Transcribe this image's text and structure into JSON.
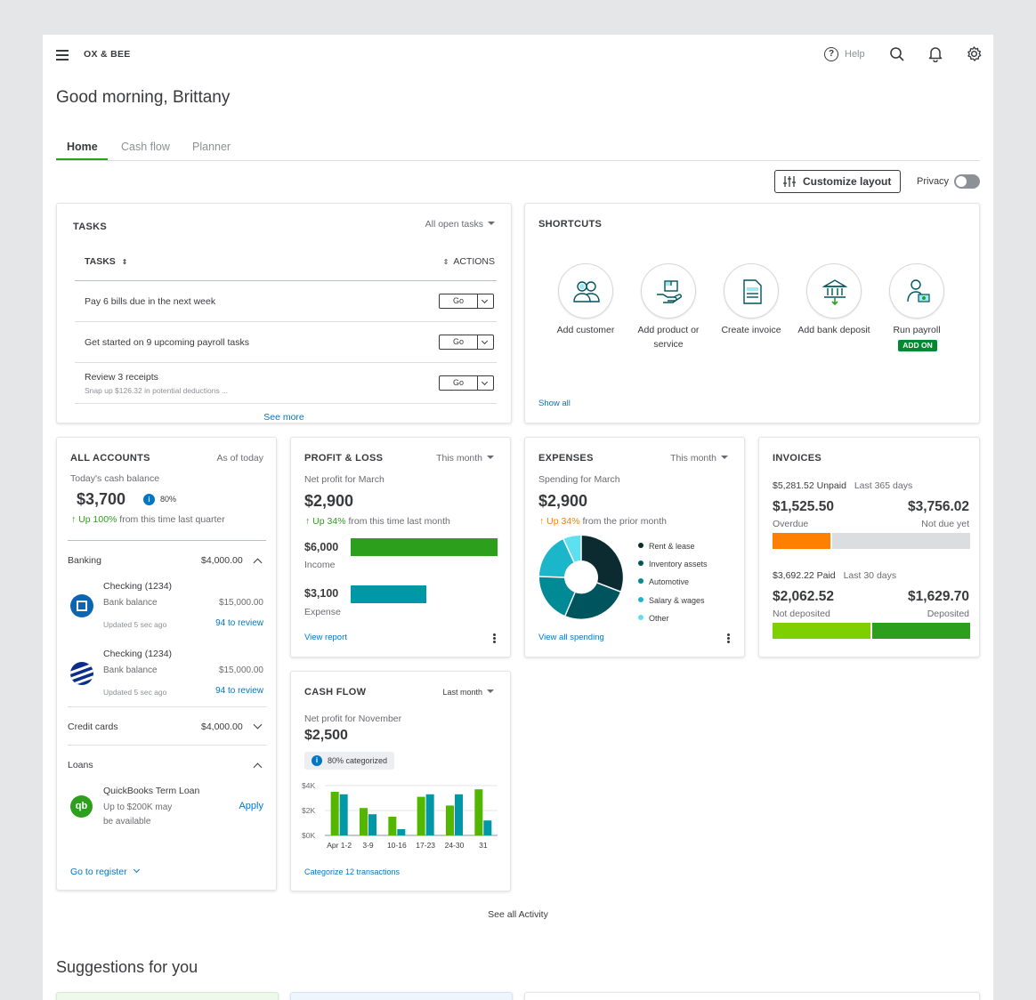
{
  "header": {
    "company": "OX & BEE",
    "help": "Help"
  },
  "greeting": "Good morning, Brittany",
  "tabs": [
    "Home",
    "Cash flow",
    "Planner"
  ],
  "customize": "Customize layout",
  "privacy": "Privacy",
  "tasks": {
    "title": "TASKS",
    "filter": "All open tasks",
    "col_tasks": "TASKS",
    "col_actions": "ACTIONS",
    "items": [
      {
        "label": "Pay 6 bills due in the next week",
        "sub": "",
        "btn": "Go"
      },
      {
        "label": "Get started on 9 upcoming payroll tasks",
        "sub": "",
        "btn": "Go"
      },
      {
        "label": "Review 3 receipts",
        "sub": "Snap up $126.32 in potential deductions ...",
        "btn": "Go"
      }
    ],
    "see_more": "See more"
  },
  "shortcuts": {
    "title": "SHORTCUTS",
    "items": [
      {
        "label": "Add customer",
        "icon": "customers-icon"
      },
      {
        "label": "Add product or service",
        "icon": "product-icon"
      },
      {
        "label": "Create invoice",
        "icon": "invoice-icon"
      },
      {
        "label": "Add bank deposit",
        "icon": "bank-deposit-icon"
      },
      {
        "label": "Run payroll",
        "icon": "payroll-icon"
      }
    ],
    "add_on": "ADD ON",
    "show_all": "Show all"
  },
  "accounts": {
    "title": "ALL ACCOUNTS",
    "as_of": "As of today",
    "cash_label": "Today's cash balance",
    "cash": "$3,700",
    "pct": "80%",
    "trend_strong": "Up 100%",
    "trend_rest": "from this time last quarter",
    "banking": "Banking",
    "banking_total": "$4,000.00",
    "bank1": {
      "name": "Checking (1234)",
      "bal_label": "Bank balance",
      "bal": "$15,000.00",
      "updated": "Updated 5 sec ago",
      "review": "94 to review"
    },
    "bank2": {
      "name": "Checking (1234)",
      "bal_label": "Bank balance",
      "bal": "$15,000.00",
      "updated": "Updated 5 sec ago",
      "review": "94 to review"
    },
    "credit": "Credit cards",
    "credit_total": "$4,000.00",
    "loans": "Loans",
    "loan_name": "QuickBooks Term Loan",
    "loan_l1": "Up to $200K may",
    "loan_l2": "be available",
    "apply": "Apply",
    "register": "Go to register"
  },
  "pl": {
    "title": "PROFIT & LOSS",
    "period": "This month",
    "label": "Net profit for March",
    "value": "$2,900",
    "trend_strong": "Up 34%",
    "trend_rest": "from this time last month",
    "income_val": "$6,000",
    "income": "Income",
    "expense_val": "$3,100",
    "expense": "Expense",
    "income_num": 6000,
    "expense_num": 3100,
    "link": "View report"
  },
  "expenses": {
    "title": "EXPENSES",
    "period": "This month",
    "label": "Spending for March",
    "value": "$2,900",
    "trend_strong": "Up 34%",
    "trend_rest": "from the prior month",
    "legend": [
      {
        "name": "Rent & lease",
        "color": "#0b2b31"
      },
      {
        "name": "Inventory assets",
        "color": "#00545e"
      },
      {
        "name": "Automotive",
        "color": "#008a95"
      },
      {
        "name": "Salary & wages",
        "color": "#1cb6cb"
      },
      {
        "name": "Other",
        "color": "#5fe0f0"
      }
    ],
    "link": "View all spending"
  },
  "invoices": {
    "title": "INVOICES",
    "unpaid": "$5,281.52 Unpaid",
    "unpaid_period": "Last 365 days",
    "overdue_val": "$1,525.50",
    "overdue": "Overdue",
    "notdue_val": "$3,756.02",
    "notdue": "Not due yet",
    "paid": "$3,692.22 Paid",
    "paid_period": "Last 30 days",
    "notdep_val": "$2,062.52",
    "notdep": "Not deposited",
    "dep_val": "$1,629.70",
    "dep": "Deposited"
  },
  "cashflow": {
    "title": "CASH FLOW",
    "period": "Last month",
    "label": "Net profit for November",
    "value": "$2,500",
    "categorized": "80% categorized",
    "link": "Categorize 12 transactions"
  },
  "chart_data": {
    "type": "bar",
    "categories": [
      "Apr 1-2",
      "3-9",
      "10-16",
      "17-23",
      "24-30",
      "31"
    ],
    "series": [
      {
        "values": [
          3.5,
          2.2,
          1.5,
          3.1,
          2.4,
          3.7
        ],
        "color": "#53b700"
      },
      {
        "values": [
          3.3,
          1.7,
          0.5,
          3.3,
          3.3,
          1.2
        ],
        "color": "#0097a7"
      }
    ],
    "yticks": [
      "$4K",
      "$2K",
      "$0K"
    ],
    "ylim": [
      0,
      4
    ]
  },
  "see_all": "See all Activity",
  "suggestions": "Suggestions for you"
}
